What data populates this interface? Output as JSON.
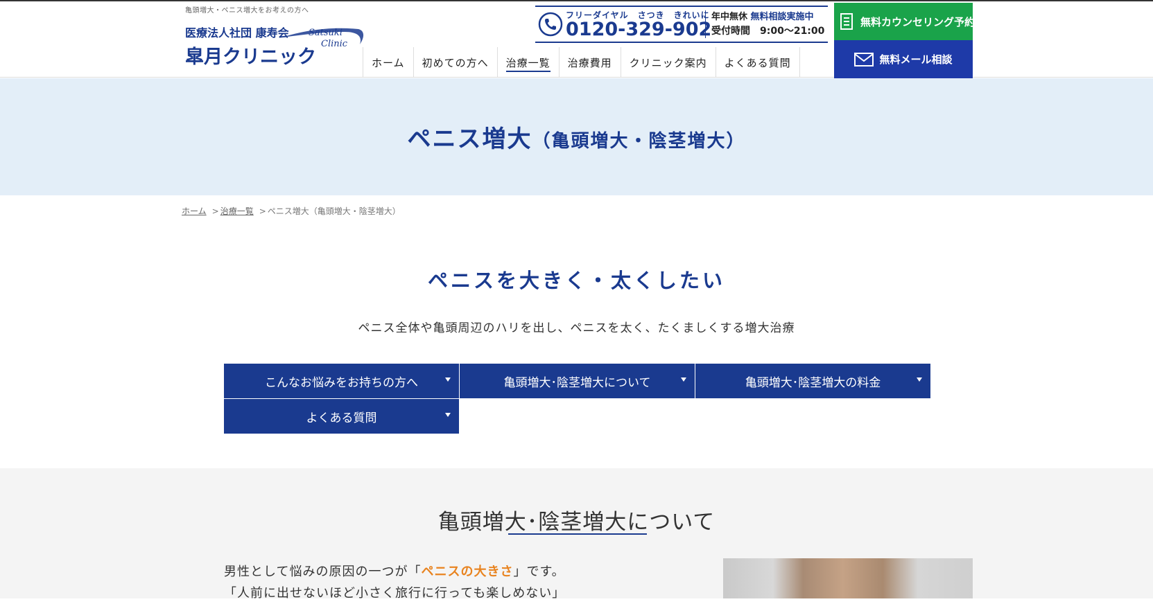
{
  "header": {
    "tagline": "亀頭増大・ペニス増大をお考えの方へ",
    "logo": {
      "corp": "医療法人社団 康寿会",
      "name": "皐月クリニック",
      "en1": "Satsuki",
      "en2": "Clinic"
    },
    "phone": {
      "caption": "フリーダイヤル　さつき　きれいに",
      "number": "0120-329-902",
      "open": "年中無休",
      "consult": "無料相談実施中",
      "hours": "受付時間　9:00〜21:00"
    },
    "counsel_button": "無料カウンセリング予約",
    "mail_button": "無料メール相談"
  },
  "nav": {
    "items": [
      "ホーム",
      "初めての方へ",
      "治療一覧",
      "治療費用",
      "クリニック案内",
      "よくある質問"
    ],
    "active_index": 2
  },
  "hero": {
    "title": "ペニス増大",
    "subtitle": "（亀頭増大・陰茎増大）"
  },
  "breadcrumb": {
    "home": "ホーム",
    "list": "治療一覧",
    "current": "ペニス増大（亀頭増大・陰茎増大）",
    "sep": ">"
  },
  "intro": {
    "catch": "ペニスを大きく・太くしたい",
    "lead": "ペニス全体や亀頭周辺のハリを出し、ペニスを太く、たくましくする増大治療"
  },
  "anchors": [
    "こんなお悩みをお持ちの方へ",
    "亀頭増大･陰茎増大について",
    "亀頭増大･陰茎増大の料金",
    "よくある質問"
  ],
  "section": {
    "title": "亀頭増大･陰茎増大について",
    "line1_pre": "男性として悩みの原因の一つが「",
    "line1_highlight": "ペニスの大きさ",
    "line1_post": "」です。",
    "line2": "「人前に出せないほど小さく旅行に行っても楽しめない」"
  },
  "colors": {
    "brand": "#1a3a8f",
    "counsel_green": "#1aa34a",
    "mail_blue": "#1e3aa8",
    "hero_bg": "#e3eef8",
    "highlight": "#e8831f"
  }
}
